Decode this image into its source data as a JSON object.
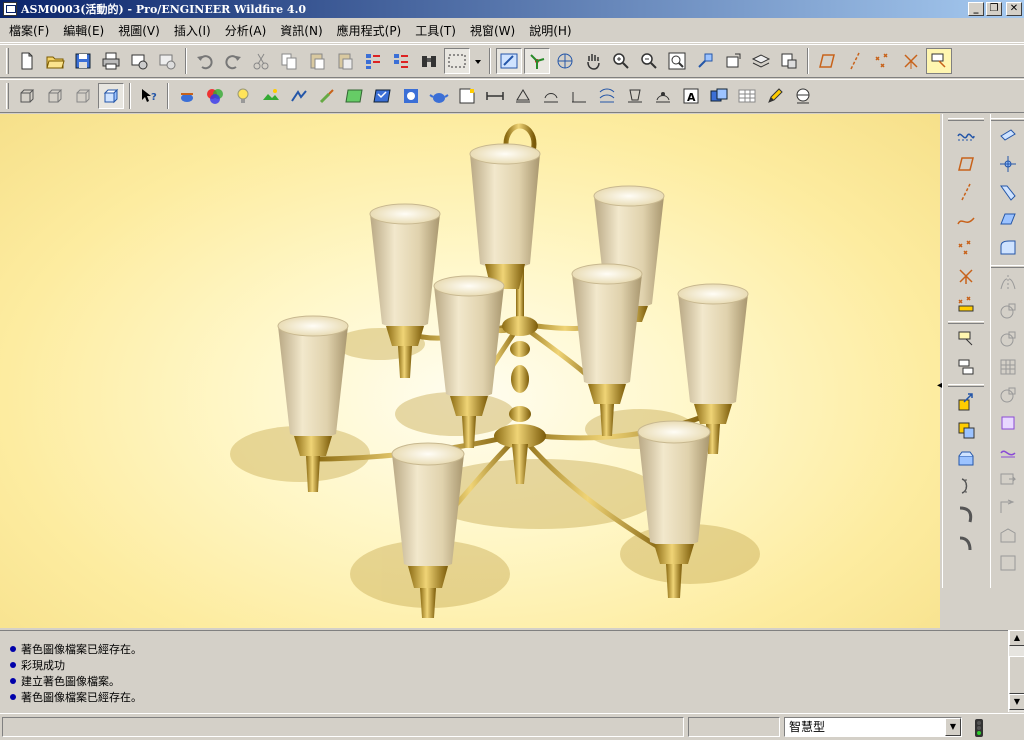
{
  "window": {
    "title": "ASM0003(活動的) - Pro/ENGINEER Wildfire 4.0",
    "minimize": "_",
    "restore": "❐",
    "close": "✕"
  },
  "menu": [
    {
      "label": "檔案(F)"
    },
    {
      "label": "編輯(E)"
    },
    {
      "label": "視圖(V)"
    },
    {
      "label": "插入(I)"
    },
    {
      "label": "分析(A)"
    },
    {
      "label": "資訊(N)"
    },
    {
      "label": "應用程式(P)"
    },
    {
      "label": "工具(T)"
    },
    {
      "label": "視窗(W)"
    },
    {
      "label": "說明(H)"
    }
  ],
  "messages": [
    {
      "text": "著色圖像檔案已經存在。"
    },
    {
      "text": "彩現成功"
    },
    {
      "text": "建立著色圖像檔案。"
    },
    {
      "text": "著色圖像檔案已經存在。"
    }
  ],
  "status": {
    "filter_value": "智慧型"
  },
  "colors": {
    "brass": "#c9a23a",
    "shade": "#e8dcb8",
    "viewport_bg": "#fff7c8",
    "titlebar": "#0a246a"
  }
}
